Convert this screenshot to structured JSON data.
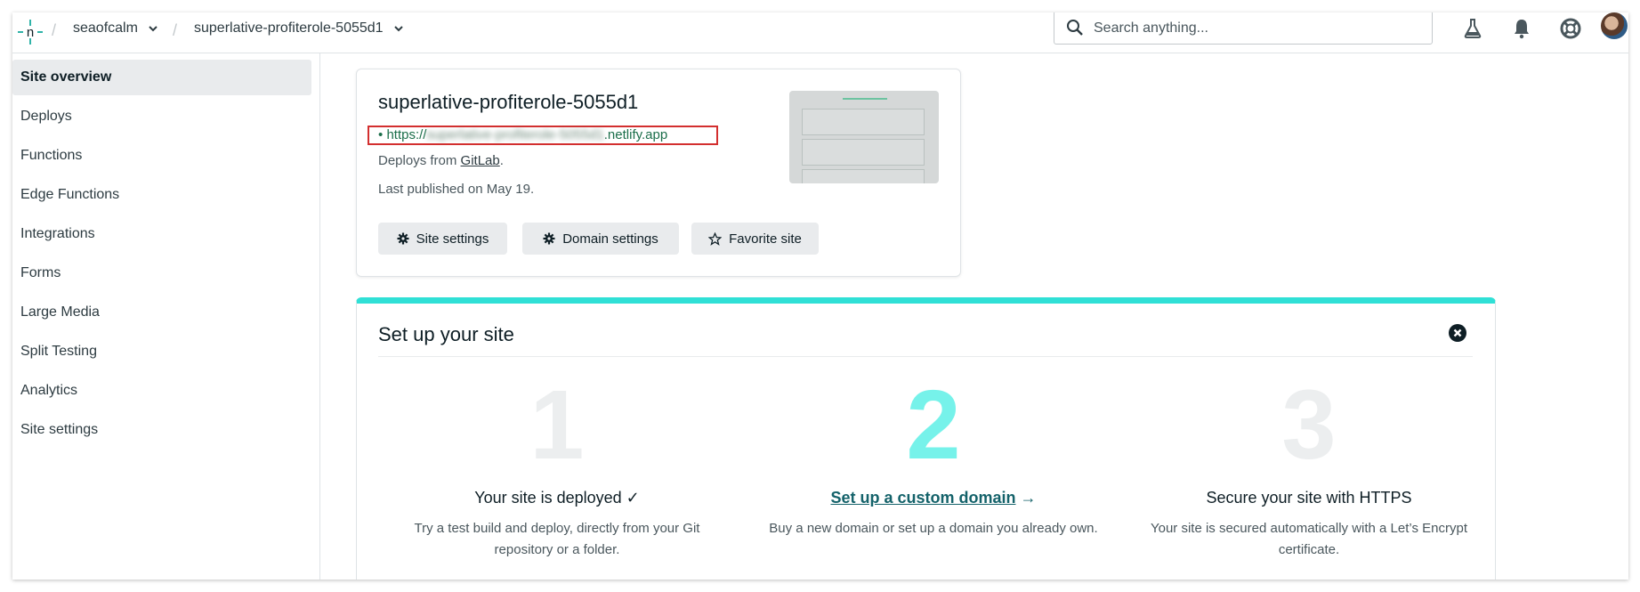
{
  "topbar": {
    "team": "seaofcalm",
    "site": "superlative-profiterole-5055d1",
    "search_placeholder": "Search anything..."
  },
  "sidebar": {
    "items": [
      {
        "label": "Site overview",
        "active": true
      },
      {
        "label": "Deploys"
      },
      {
        "label": "Functions"
      },
      {
        "label": "Edge Functions"
      },
      {
        "label": "Integrations"
      },
      {
        "label": "Forms"
      },
      {
        "label": "Large Media"
      },
      {
        "label": "Split Testing"
      },
      {
        "label": "Analytics"
      },
      {
        "label": "Site settings"
      }
    ]
  },
  "site_card": {
    "title": "superlative-profiterole-5055d1",
    "url_prefix": "https://",
    "url_blurred": "superlative-profiterole-5055d1",
    "url_suffix": ".netlify.app",
    "deploys_from_text": "Deploys from",
    "deploys_from_link": "GitLab",
    "published": "Last published on May 19.",
    "buttons": {
      "site_settings": "Site settings",
      "domain_settings": "Domain settings",
      "favorite": "Favorite site"
    }
  },
  "setup": {
    "title": "Set up your site",
    "steps": [
      {
        "number": "1",
        "title": "Your site is deployed ✓",
        "desc": "Try a test build and deploy, directly from your Git repository or a folder."
      },
      {
        "number": "2",
        "title": "Set up a custom domain",
        "arrow": "→",
        "desc": "Buy a new domain or set up a domain you already own."
      },
      {
        "number": "3",
        "title": "Secure your site with HTTPS",
        "desc": "Your site is secured automatically with a Let’s Encrypt certificate."
      }
    ]
  },
  "colors": {
    "accent_teal": "#30e0d6",
    "active_step": "#76f2ea",
    "url_green": "#1b6e4a",
    "highlight_red": "#d32f2f"
  }
}
